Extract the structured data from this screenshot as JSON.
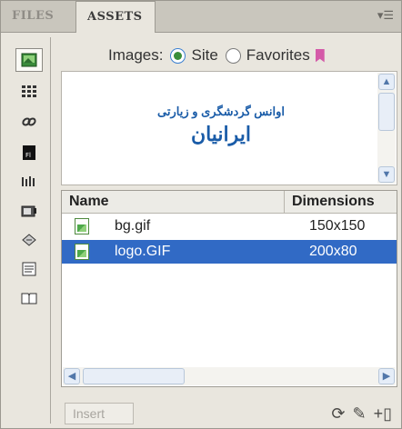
{
  "tabs": {
    "files": "FILES",
    "assets": "ASSETS"
  },
  "panel_menu_icon": "panel-options-icon",
  "filter": {
    "label": "Images:",
    "options": [
      {
        "label": "Site",
        "selected": true
      },
      {
        "label": "Favorites",
        "selected": false
      }
    ]
  },
  "sidebar": {
    "categories": [
      {
        "name": "images-icon",
        "active": true
      },
      {
        "name": "colors-icon",
        "active": false
      },
      {
        "name": "urls-icon",
        "active": false
      },
      {
        "name": "flash-icon",
        "active": false
      },
      {
        "name": "shockwave-icon",
        "active": false
      },
      {
        "name": "movies-icon",
        "active": false
      },
      {
        "name": "scripts-icon",
        "active": false
      },
      {
        "name": "templates-icon",
        "active": false
      },
      {
        "name": "library-icon",
        "active": false
      }
    ]
  },
  "preview": {
    "line1": "اوانس گردشگری و زیارتی",
    "line2": "ایرانیان"
  },
  "table": {
    "columns": [
      "Name",
      "Dimensions"
    ],
    "rows": [
      {
        "name": "bg.gif",
        "dimensions": "150x150",
        "selected": false
      },
      {
        "name": "logo.GIF",
        "dimensions": "200x80",
        "selected": true
      }
    ]
  },
  "bottom": {
    "insert_label": "Insert",
    "icons": [
      "refresh-icon",
      "edit-icon",
      "add-to-favorites-icon"
    ]
  },
  "colors": {
    "selection": "#316ac5",
    "preview_text": "#1a5ca8",
    "panel_bg": "#e9e6de"
  }
}
